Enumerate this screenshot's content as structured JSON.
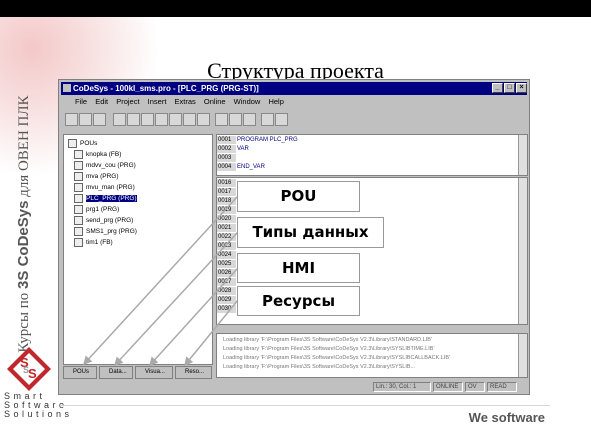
{
  "slide": {
    "title": "Структура проекта",
    "side_text_prefix": "Курсы по ",
    "side_text_brand": "3S CoDeSys",
    "side_text_suffix": " для ОВЕН ПЛК",
    "logo_lines": [
      "S m a r t",
      "S o f t w a r e",
      "S o l u t i o n s"
    ],
    "footer": "We software"
  },
  "window": {
    "title": "CoDeSys - 100kl_sms.pro - [PLC_PRG (PRG-ST)]",
    "menu": [
      "File",
      "Edit",
      "Project",
      "Insert",
      "Extras",
      "Online",
      "Window",
      "Help"
    ],
    "controls": [
      "_",
      "□",
      "×"
    ]
  },
  "tree": {
    "root": "POUs",
    "items": [
      {
        "label": "knopka (FB)",
        "selected": false
      },
      {
        "label": "mdvv_cou (PRG)",
        "selected": false
      },
      {
        "label": "mva (PRG)",
        "selected": false
      },
      {
        "label": "mvu_man (PRG)",
        "selected": false
      },
      {
        "label": "PLC_PRG (PRG)",
        "selected": true
      },
      {
        "label": "prg1 (PRG)",
        "selected": false
      },
      {
        "label": "send_prg (PRG)",
        "selected": false
      },
      {
        "label": "SMS1_prg (PRG)",
        "selected": false
      },
      {
        "label": "tim1 (FB)",
        "selected": false
      }
    ]
  },
  "tabs": [
    "POUs",
    "Data...",
    "Visua...",
    "Reso..."
  ],
  "code_top": [
    {
      "n": "0001",
      "t": "PROGRAM PLC_PRG"
    },
    {
      "n": "0002",
      "t": "VAR"
    },
    {
      "n": "0003",
      "t": ""
    },
    {
      "n": "0004",
      "t": "END_VAR"
    }
  ],
  "code_lines": [
    "0016",
    "0017",
    "0018",
    "0019",
    "0020",
    "0021",
    "0022",
    "0023",
    "0024",
    "0025",
    "0026",
    "0027",
    "0028",
    "0029",
    "0030"
  ],
  "messages": [
    "Loading library 'F:\\Program Files\\3S Software\\CoDeSys V2.3\\Library\\STANDARD.LIB'",
    "Loading library 'F:\\Program Files\\3S Software\\CoDeSys V2.3\\Library\\SYSLIBTIME.LIB'",
    "Loading library 'F:\\Program Files\\3S Software\\CoDeSys V2.3\\Library\\SYSLIBCALLBACK.LIB'",
    "Loading library 'F:\\Program Files\\3S Software\\CoDeSys V2.3\\Library\\SYSLIB..."
  ],
  "status": {
    "position": "Lin.: 30, Col.: 1",
    "online": "ONLINE",
    "ov": "OV",
    "read": "READ"
  },
  "callouts": {
    "pou": "POU",
    "data_types": "Типы данных",
    "hmi": "HMI",
    "resources": "Ресурсы"
  },
  "colors": {
    "titlebar": "#000080",
    "window_gray": "#c0c0c0",
    "side_text": "#555555",
    "logo_red": "#c0282d"
  }
}
